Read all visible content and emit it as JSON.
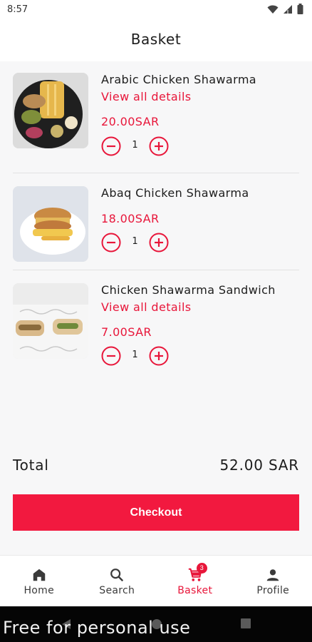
{
  "status_bar": {
    "time": "8:57"
  },
  "header": {
    "title": "Basket"
  },
  "items": [
    {
      "name": "Arabic Chicken Shawarma",
      "details_link": "View all details",
      "price": "20.00SAR",
      "quantity": "1"
    },
    {
      "name": "Abaq Chicken Shawarma",
      "price": "18.00SAR",
      "quantity": "1"
    },
    {
      "name": "Chicken Shawarma Sandwich",
      "details_link": "View all details",
      "price": "7.00SAR",
      "quantity": "1"
    }
  ],
  "summary": {
    "total_label": "Total",
    "total_value": "52.00 SAR"
  },
  "checkout_label": "Checkout",
  "bottom_nav": {
    "items": [
      {
        "label": "Home",
        "icon": "home-icon"
      },
      {
        "label": "Search",
        "icon": "search-icon"
      },
      {
        "label": "Basket",
        "icon": "cart-icon",
        "badge": "3",
        "active": true
      },
      {
        "label": "Profile",
        "icon": "profile-icon"
      }
    ]
  },
  "watermark": "Free for personal use",
  "colors": {
    "accent": "#e8163a",
    "checkout_bg": "#f2193f"
  }
}
